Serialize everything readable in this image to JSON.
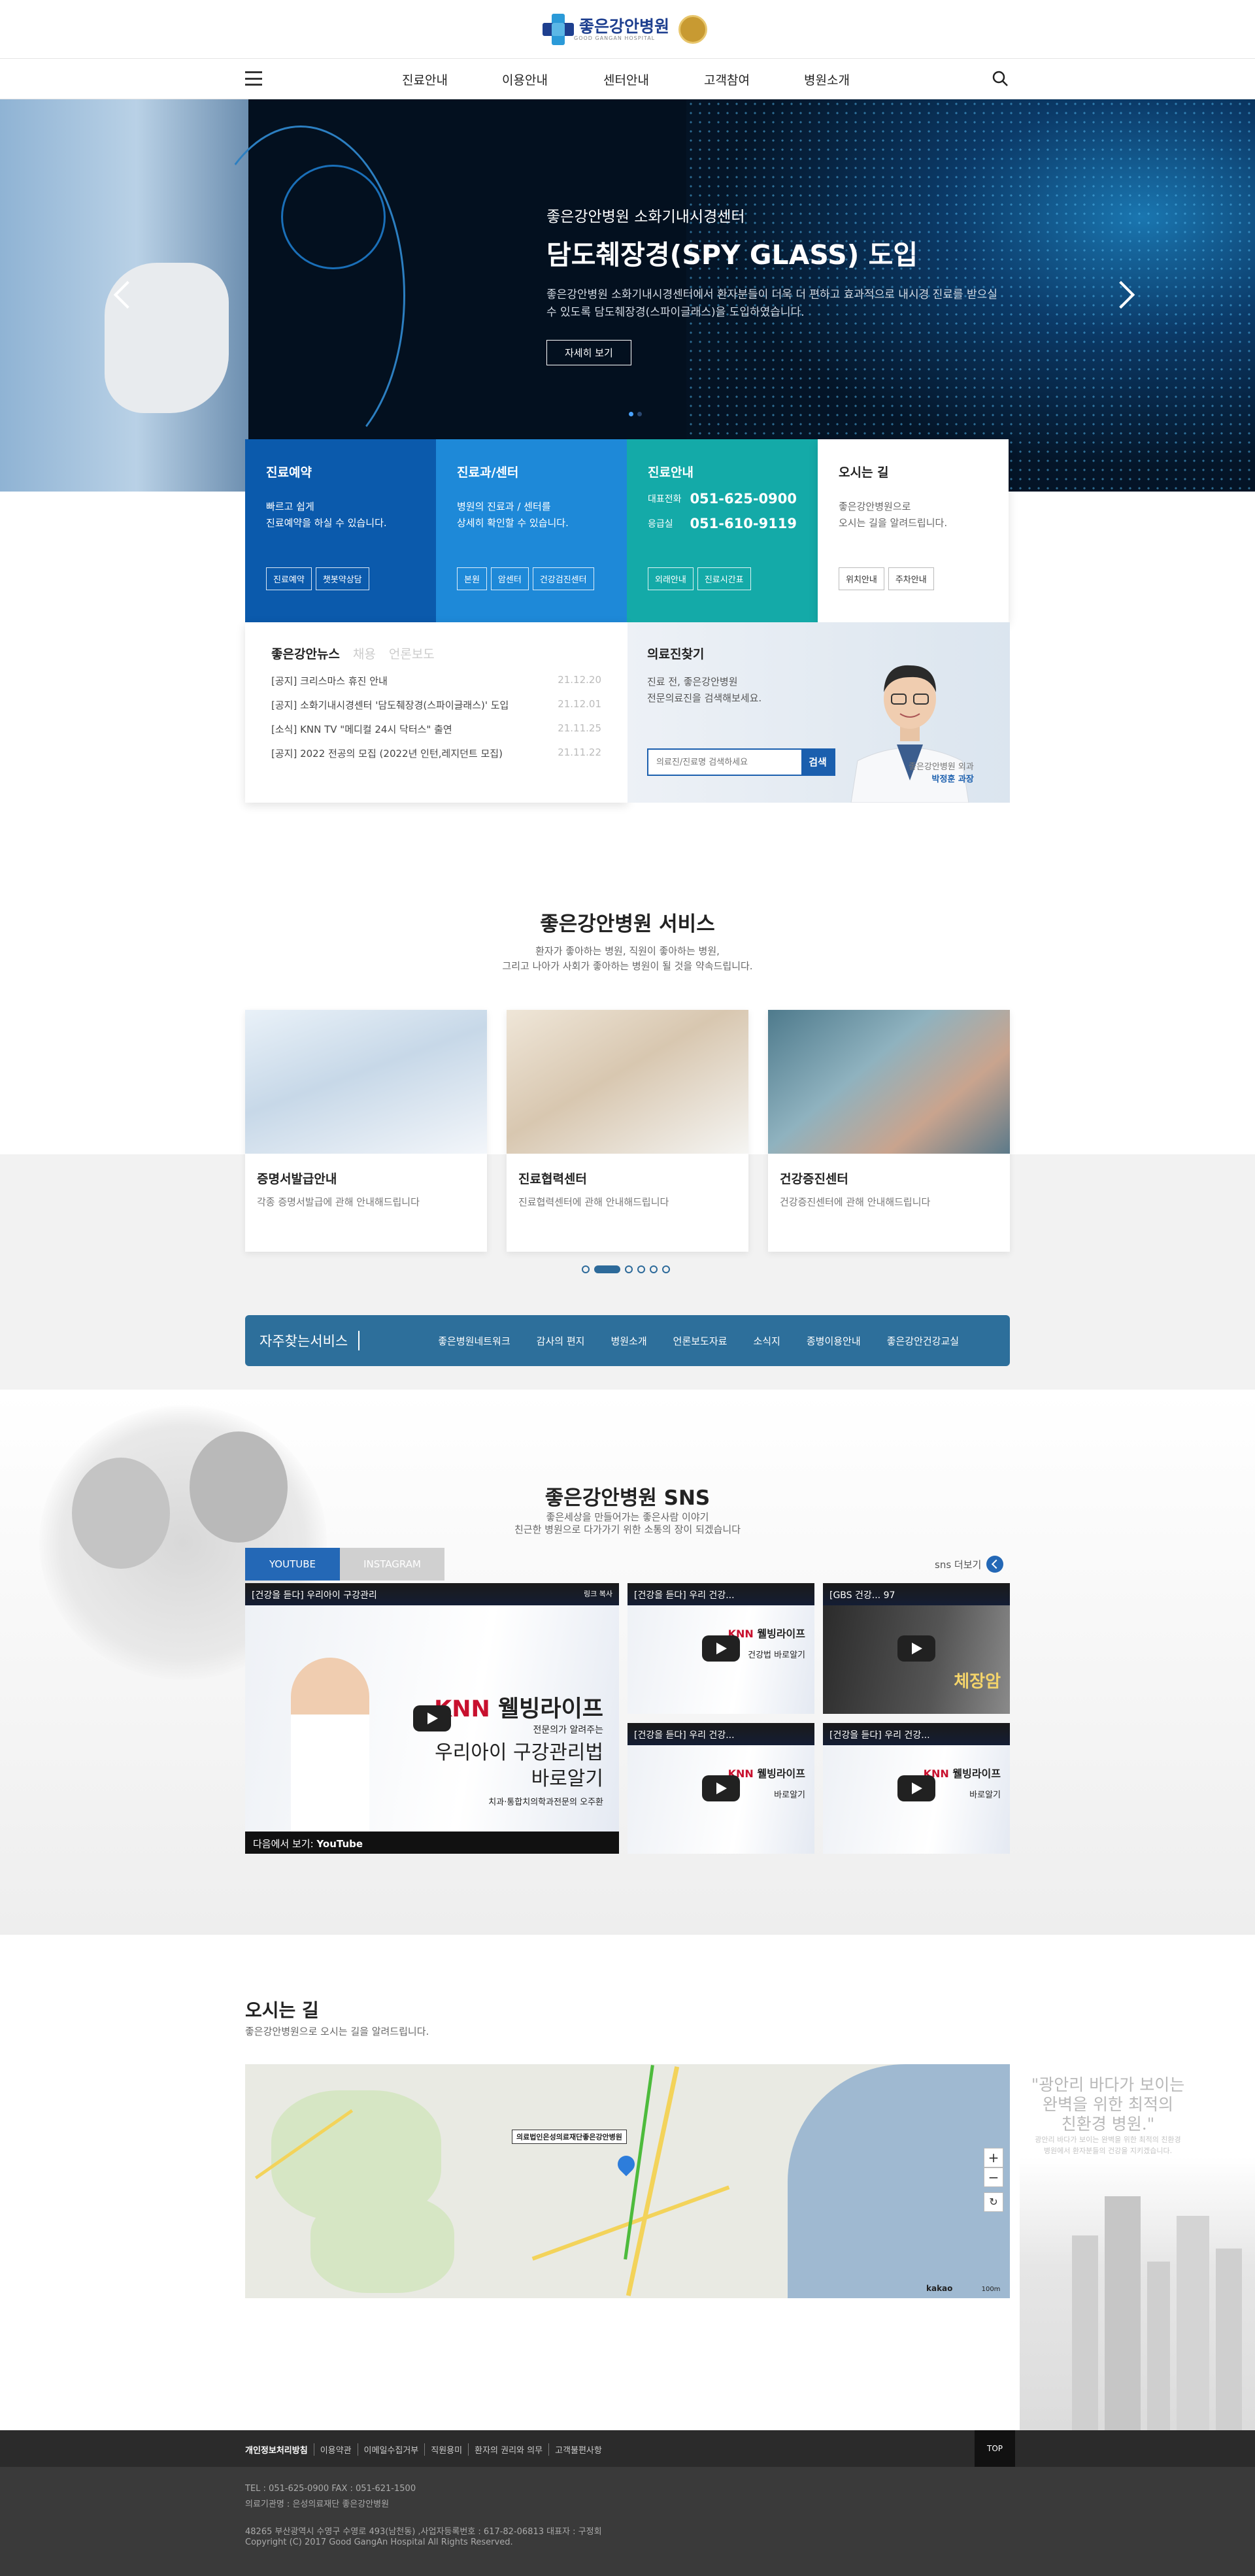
{
  "header": {
    "logo_name": "좋은강안병원",
    "logo_sub": "GOOD GANGAN HOSPITAL",
    "nav": [
      "진료안내",
      "이용안내",
      "센터안내",
      "고객참여",
      "병원소개"
    ]
  },
  "hero": {
    "subtitle": "좋은강안병원 소화기내시경센터",
    "title": "담도췌장경(SPY GLASS) 도입",
    "desc": "좋은강안병원 소화기내시경센터에서 환자분들이 더욱 더 편하고 효과적으로 내시경 진료를 받으실 수 있도록 담도췌장경(스파이글래스)을 도입하였습니다.",
    "button": "자세히 보기"
  },
  "quick": {
    "reserve": {
      "title": "진료예약",
      "desc1": "빠르고 쉽게",
      "desc2": "진료예약을 하실 수 있습니다.",
      "btn1": "진료예약",
      "btn2": "챗봇약상담"
    },
    "dept": {
      "title": "진료과/센터",
      "desc1": "병원의 진료과 / 센터를",
      "desc2": "상세히 확인할 수 있습니다.",
      "btn1": "본원",
      "btn2": "암센터",
      "btn3": "건강검진센터"
    },
    "info": {
      "title": "진료안내",
      "label1": "대표전화",
      "phone1": "051-625-0900",
      "label2": "응급실",
      "phone2": "051-610-9119",
      "btn1": "외래안내",
      "btn2": "진료시간표"
    },
    "map": {
      "title": "오시는 길",
      "desc1": "좋은강안병원으로",
      "desc2": "오시는 길을 알려드립니다.",
      "btn1": "위치안내",
      "btn2": "주차안내"
    }
  },
  "news": {
    "tabs": [
      "좋은강안뉴스",
      "채용",
      "언론보도"
    ],
    "items": [
      {
        "title": "[공지] 크리스마스 휴진 안내",
        "date": "21.12.20"
      },
      {
        "title": "[공지] 소화기내시경센터 '담도췌장경(스파이글래스)' 도입",
        "date": "21.12.01"
      },
      {
        "title": "[소식] KNN TV \"메디컬 24시 닥터스\" 출연",
        "date": "21.11.25"
      },
      {
        "title": "[공지] 2022 전공의 모집 (2022년 인턴,레지던트 모집)",
        "date": "21.11.22"
      }
    ]
  },
  "doctor": {
    "title": "의료진찾기",
    "desc1": "진료 전, 좋은강안병원",
    "desc2": "전문의료진을 검색해보세요.",
    "placeholder": "의료진/진료명 검색하세요",
    "search_btn": "검색",
    "caption1": "좋은강안병원 외과",
    "caption2": "박정훈 과장"
  },
  "service": {
    "title": "좋은강안병원 서비스",
    "desc1": "환자가 좋아하는 병원, 직원이 좋아하는 병원,",
    "desc2": "그리고 나아가 사회가 좋아하는 병원이 될 것을 약속드립니다.",
    "cards": [
      {
        "title": "증명서발급안내",
        "desc": "각종 증명서발급에 관해 안내해드립니다"
      },
      {
        "title": "진료협력센터",
        "desc": "진료협력센터에 관해 안내해드립니다"
      },
      {
        "title": "건강증진센터",
        "desc": "건강증진센터에 관해 안내해드립니다"
      }
    ]
  },
  "quickbar": {
    "label": "자주찾는서비스",
    "links": [
      "좋은병원네트워크",
      "감사의 편지",
      "병원소개",
      "언론보도자료",
      "소식지",
      "종병이용안내",
      "좋은강안건강교실"
    ]
  },
  "sns": {
    "title": "좋은강안병원 SNS",
    "desc1": "좋은세상을 만들어가는 좋은사람 이야기",
    "desc2": "친근한 병원으로 다가가기 위한 소통의 장이 되겠습니다",
    "tabs": [
      "YOUTUBE",
      "INSTAGRAM"
    ],
    "more": "sns 더보기",
    "main_video": {
      "title": "[건강을 듣다] 우리아이 구강관리",
      "copy": "링크 복사",
      "brand": "웰빙라이프",
      "line1": "전문의가 알려주는",
      "line2": "우리아이 구강관리법",
      "line3": "바로알기",
      "doctor": "치과·통합치의학과전문의 오주환",
      "watch": "다음에서 보기:",
      "yt": "YouTube"
    },
    "videos": [
      {
        "title": "[건강을 듣다] 우리 건강...",
        "brand": "웰빙라이프",
        "line": "건강법 바로알기"
      },
      {
        "title": "[GBS 건강... 97",
        "brand": "",
        "line": "체장암"
      },
      {
        "title": "[건강을 듣다] 우리 건강...",
        "brand": "웰빙라이프",
        "line": "바로알기"
      },
      {
        "title": "[건강을 듣다] 우리 건강...",
        "brand": "웰빙라이프",
        "line": "바로알기"
      }
    ]
  },
  "location": {
    "title": "오시는 길",
    "desc": "좋은강안병원으로 오시는 길을 알려드립니다.",
    "map_label": "의료법인은성의료재단좋은강안병원",
    "zoom_in": "+",
    "zoom_out": "−",
    "refresh": "↻",
    "kakao": "kakao",
    "scale": "100m",
    "quote1": "\"광안리 바다가 보이는",
    "quote2": "완벽을 위한 최적의",
    "quote3": "친환경 병원.\"",
    "quote_sub": "광안리 바다가 보이는 완벽을 위한 최적의 친환경 병원에서 환자분들의 건강을 지키겠습니다."
  },
  "footer": {
    "links": [
      "개인정보처리방침",
      "이용약관",
      "이메일수집거부",
      "직원용미",
      "환자의 권리와 의무",
      "고객불편사항"
    ],
    "top": "TOP",
    "tel": "TEL : 051-625-0900  FAX : 051-621-1500",
    "org": "의료기관명 : 은성의료재단 좋은강안병원",
    "addr": "48265 부산광역시 수영구 수영로 493(남천동) ,사업자등록번호 : 617-82-06813 대표자 : 구정회",
    "copy": "Copyright (C) 2017 Good GangAn Hospital All Rights Reserved."
  },
  "colors": {
    "reserve": "#0b5aac",
    "dept": "#1e89d8",
    "info": "#14aaa8",
    "accent": "#2468b6",
    "quickbar": "#2d6f9b"
  }
}
